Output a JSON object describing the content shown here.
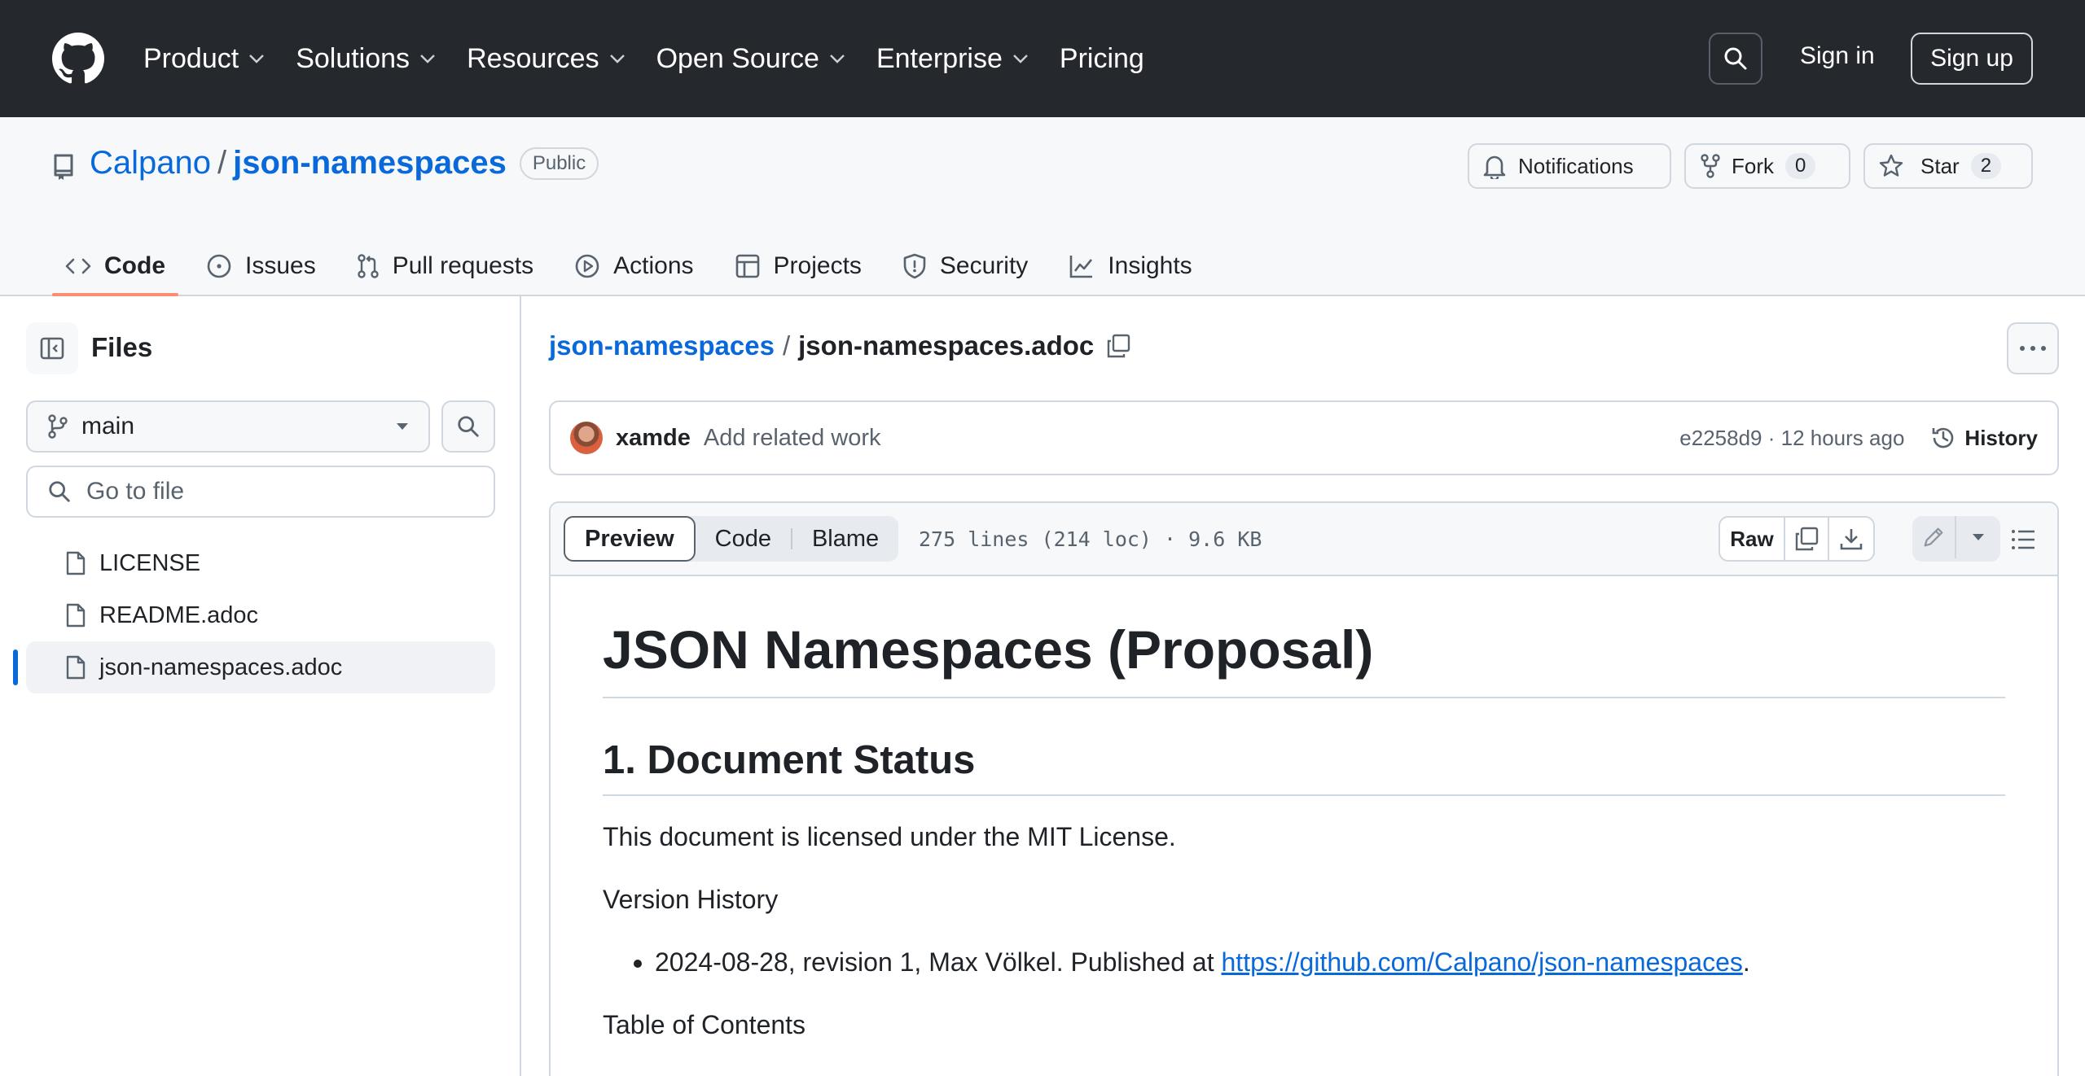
{
  "header": {
    "nav": [
      {
        "label": "Product",
        "has_menu": true
      },
      {
        "label": "Solutions",
        "has_menu": true
      },
      {
        "label": "Resources",
        "has_menu": true
      },
      {
        "label": "Open Source",
        "has_menu": true
      },
      {
        "label": "Enterprise",
        "has_menu": true
      },
      {
        "label": "Pricing",
        "has_menu": false
      }
    ],
    "sign_in": "Sign in",
    "sign_up": "Sign up"
  },
  "repo": {
    "owner": "Calpano",
    "separator": "/",
    "name": "json-namespaces",
    "visibility": "Public",
    "notifications_label": "Notifications",
    "fork_label": "Fork",
    "fork_count": "0",
    "star_label": "Star",
    "star_count": "2",
    "tabs": [
      {
        "label": "Code",
        "icon": "code-icon",
        "active": true
      },
      {
        "label": "Issues",
        "icon": "issue-icon",
        "active": false
      },
      {
        "label": "Pull requests",
        "icon": "pull-request-icon",
        "active": false
      },
      {
        "label": "Actions",
        "icon": "play-icon",
        "active": false
      },
      {
        "label": "Projects",
        "icon": "table-icon",
        "active": false
      },
      {
        "label": "Security",
        "icon": "shield-icon",
        "active": false
      },
      {
        "label": "Insights",
        "icon": "graph-icon",
        "active": false
      }
    ]
  },
  "sidebar": {
    "title": "Files",
    "branch": "main",
    "goto_placeholder": "Go to file",
    "files": [
      {
        "name": "LICENSE",
        "selected": false
      },
      {
        "name": "README.adoc",
        "selected": false
      },
      {
        "name": "json-namespaces.adoc",
        "selected": true
      }
    ]
  },
  "breadcrumb": {
    "repo": "json-namespaces",
    "separator": "/",
    "file": "json-namespaces.adoc"
  },
  "commit": {
    "author": "xamde",
    "message": "Add related work",
    "meta": "e2258d9 · 12 hours ago",
    "history_label": "History"
  },
  "file_view": {
    "tabs": [
      "Preview",
      "Code",
      "Blame"
    ],
    "active_tab": "Preview",
    "info": "275 lines (214 loc) · 9.6 KB",
    "raw_label": "Raw"
  },
  "document": {
    "title": "JSON Namespaces (Proposal)",
    "section1": "1. Document Status",
    "license_text": "This document is licensed under the MIT License.",
    "version_history_label": "Version History",
    "history_item_text": "2024-08-28, revision 1, Max Völkel. Published at ",
    "history_item_link": "https://github.com/Calpano/json-namespaces",
    "history_item_end": ".",
    "toc_label": "Table of Contents"
  },
  "colors": {
    "header_bg": "#25292e",
    "link": "#0969da",
    "active_tab_underline": "#fd8c73",
    "subtle_bg": "#f6f8fa",
    "border": "#d0d7de"
  }
}
